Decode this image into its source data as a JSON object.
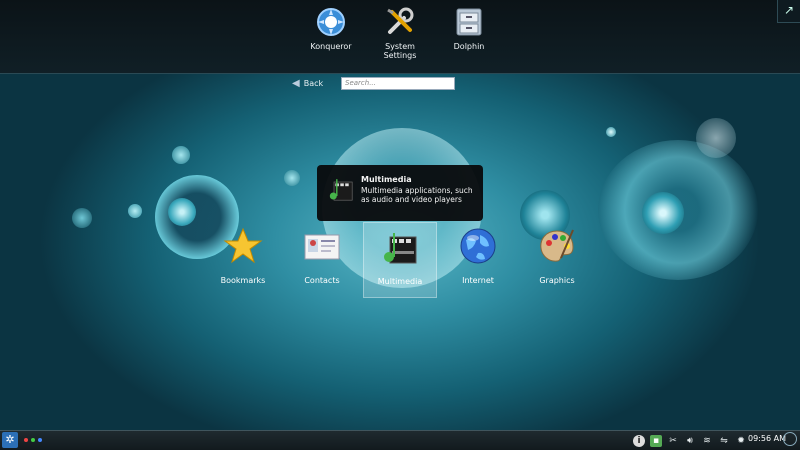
{
  "favorites": [
    {
      "label": "Konqueror",
      "icon": "konqueror-icon"
    },
    {
      "label": "System\nSettings",
      "icon": "system-settings-icon"
    },
    {
      "label": "Dolphin",
      "icon": "dolphin-icon"
    }
  ],
  "nav": {
    "back_label": "Back",
    "search_placeholder": "Search..."
  },
  "tooltip": {
    "title": "Multimedia",
    "description": "Multimedia applications, such as audio and video players",
    "icon": "multimedia-icon"
  },
  "categories": [
    {
      "label": "Bookmarks",
      "icon": "star-icon"
    },
    {
      "label": "Contacts",
      "icon": "contacts-card-icon"
    },
    {
      "label": "Multimedia",
      "icon": "multimedia-icon",
      "selected": true
    },
    {
      "label": "Internet",
      "icon": "globe-icon"
    },
    {
      "label": "Graphics",
      "icon": "palette-icon"
    }
  ],
  "panel": {
    "clock": "09:56 AM"
  },
  "colors": {
    "accent": "#2c6fb6",
    "background": "#2f8ea3",
    "panel": "#121a1e"
  }
}
